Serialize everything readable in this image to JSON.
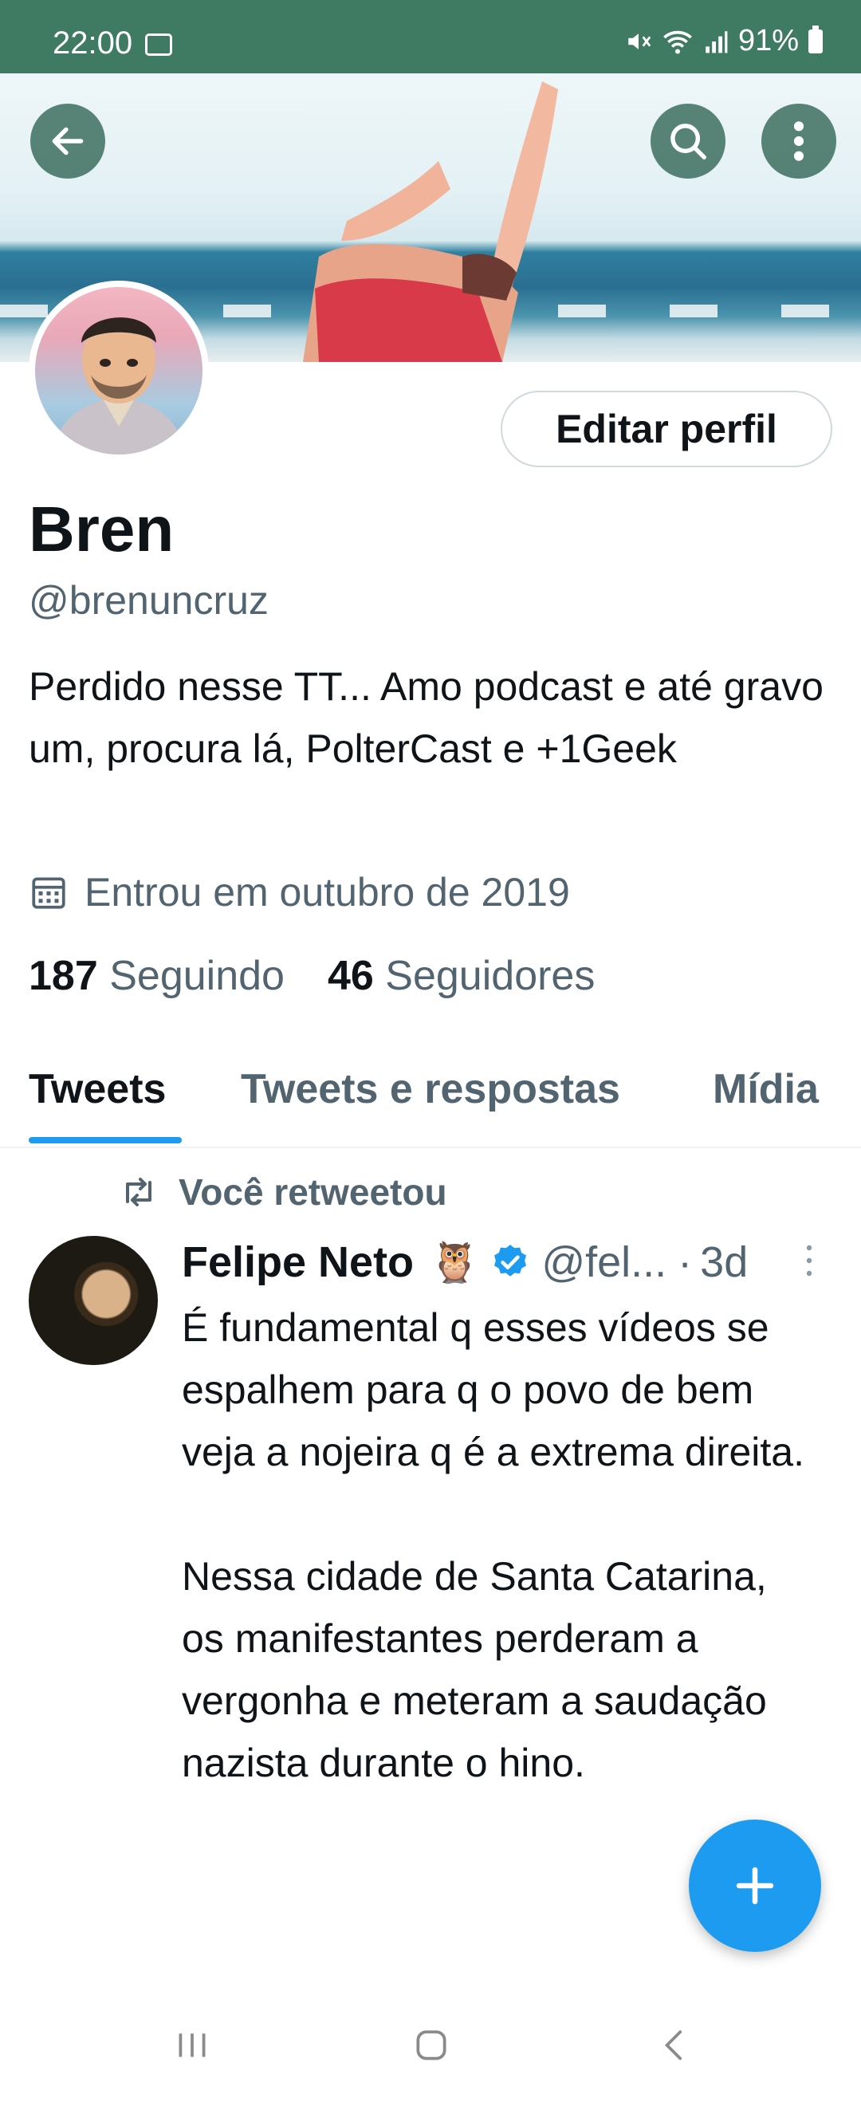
{
  "status_bar": {
    "time": "22:00",
    "battery": "91%"
  },
  "profile": {
    "edit_label": "Editar perfil",
    "name": "Bren",
    "handle": "@brenuncruz",
    "bio": "Perdido nesse TT... Amo podcast e até gravo um, procura lá, PolterCast e +1Geek",
    "joined": "Entrou em outubro de 2019",
    "following_count": "187",
    "following_label": "Seguindo",
    "followers_count": "46",
    "followers_label": "Seguidores"
  },
  "tabs": [
    {
      "label": "Tweets",
      "active": true
    },
    {
      "label": "Tweets e respostas",
      "active": false
    },
    {
      "label": "Mídia",
      "active": false
    }
  ],
  "tweet": {
    "retweet_label": "Você retweetou",
    "author": "Felipe Neto",
    "emoji": "🦉",
    "username": "@fel...",
    "separator": "·",
    "time": "3d",
    "text": "É fundamental q esses vídeos se espalhem para q o povo de bem veja a nojeira q é a extrema direita.\n\nNessa cidade de Santa Catarina, os manifestantes perderam a vergonha e meteram a saudação nazista durante o hino."
  },
  "colors": {
    "status_bar": "#3f7a62",
    "accent": "#1d9bf0",
    "secondary_text": "#536471",
    "primary_text": "#0f1419"
  },
  "icons": [
    "back-arrow-icon",
    "search-icon",
    "more-vertical-icon",
    "calendar-icon",
    "retweet-icon",
    "verified-badge-icon",
    "plus-icon",
    "recent-apps-icon",
    "home-icon",
    "nav-back-icon"
  ]
}
